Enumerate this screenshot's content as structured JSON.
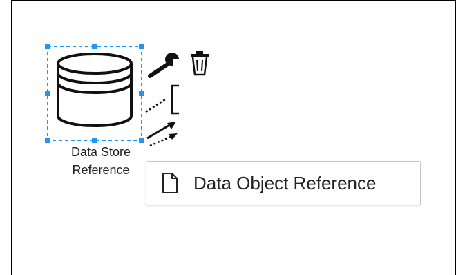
{
  "element": {
    "label_line1": "Data Store",
    "label_line2": "Reference",
    "icon": "database-icon"
  },
  "context_pad": {
    "tools": [
      "wrench-icon",
      "trash-icon",
      "annotation-icon",
      "association-arrow-icon",
      "data-association-arrow-icon"
    ]
  },
  "tooltip": {
    "text": "Data Object Reference",
    "icon": "document-icon"
  },
  "colors": {
    "selection": "#2196f3",
    "stroke": "#111111"
  }
}
